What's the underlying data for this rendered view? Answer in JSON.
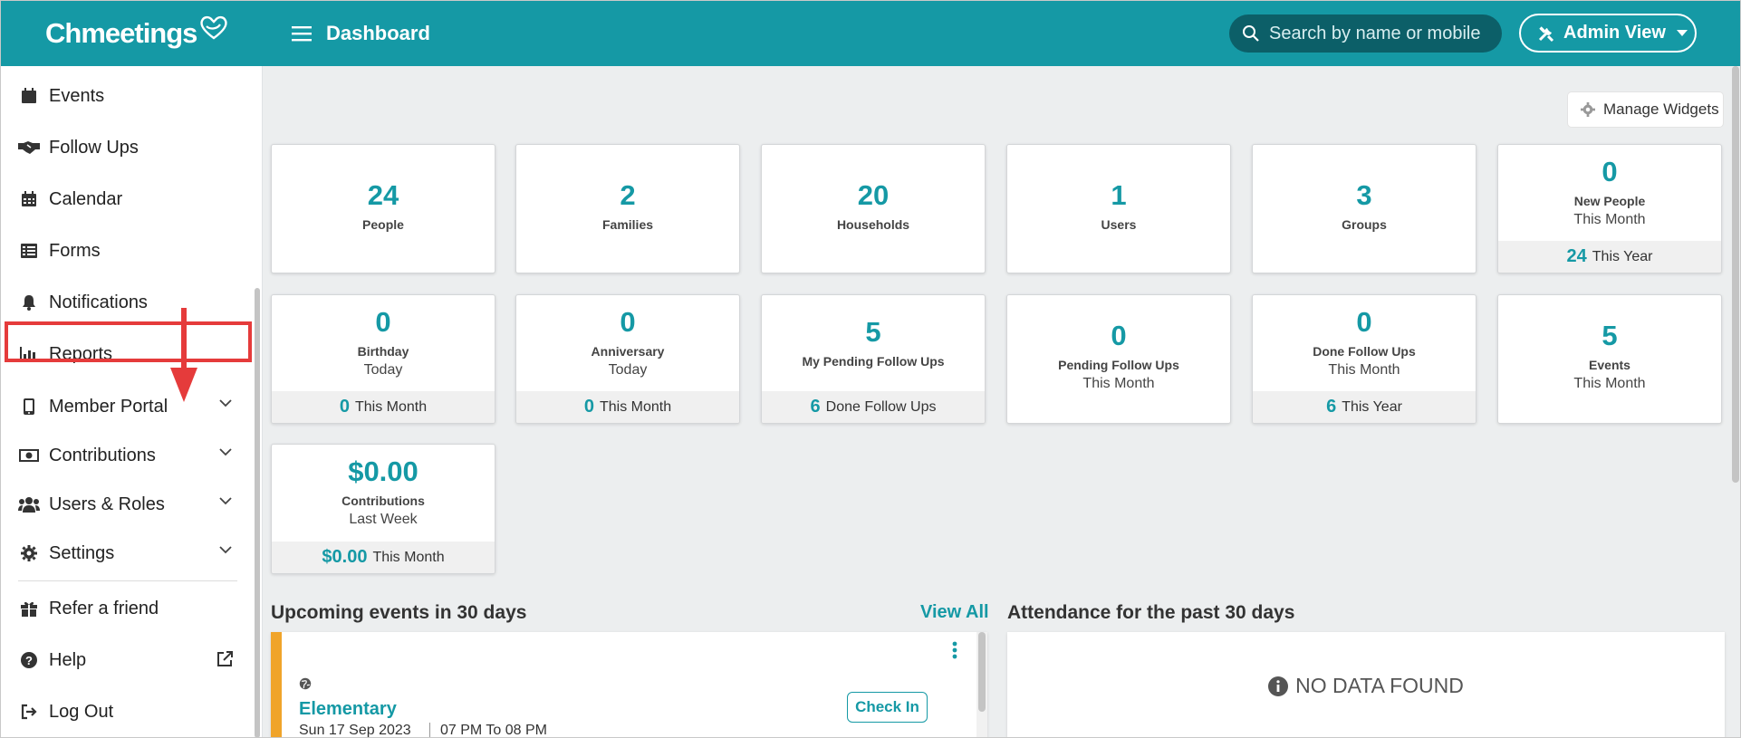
{
  "app": {
    "brand": "Chmeetings",
    "page_title": "Dashboard"
  },
  "header": {
    "search_placeholder": "Search by name or mobile",
    "admin_view_label": "Admin View"
  },
  "sidebar": {
    "items": [
      {
        "label": "Events",
        "icon": "calendar-icon"
      },
      {
        "label": "Follow Ups",
        "icon": "handshake-icon"
      },
      {
        "label": "Calendar",
        "icon": "calendar-grid-icon"
      },
      {
        "label": "Forms",
        "icon": "list-icon"
      },
      {
        "label": "Notifications",
        "icon": "bell-icon"
      },
      {
        "label": "Reports",
        "icon": "bar-chart-icon"
      },
      {
        "label": "Member Portal",
        "icon": "mobile-icon"
      },
      {
        "label": "Contributions",
        "icon": "money-icon"
      },
      {
        "label": "Users & Roles",
        "icon": "users-icon"
      },
      {
        "label": "Settings",
        "icon": "gear-icon"
      },
      {
        "label": "Refer a friend",
        "icon": "gift-icon"
      },
      {
        "label": "Help",
        "icon": "question-icon"
      },
      {
        "label": "Log Out",
        "icon": "logout-icon"
      }
    ]
  },
  "main": {
    "manage_widgets_label": "Manage Widgets",
    "widgets": {
      "people": {
        "value": "24",
        "label": "People"
      },
      "families": {
        "value": "2",
        "label": "Families"
      },
      "households": {
        "value": "20",
        "label": "Households"
      },
      "users": {
        "value": "1",
        "label": "Users"
      },
      "groups": {
        "value": "3",
        "label": "Groups"
      },
      "new_people": {
        "value": "0",
        "label": "New People",
        "sub": "This Month",
        "foot_value": "24",
        "foot_label": "This Year"
      },
      "birthday": {
        "value": "0",
        "label": "Birthday",
        "sub": "Today",
        "foot_value": "0",
        "foot_label": "This Month"
      },
      "anniversary": {
        "value": "0",
        "label": "Anniversary",
        "sub": "Today",
        "foot_value": "0",
        "foot_label": "This Month"
      },
      "my_pending": {
        "value": "5",
        "label": "My Pending Follow Ups",
        "foot_value": "6",
        "foot_label": "Done Follow Ups"
      },
      "pending": {
        "value": "0",
        "label": "Pending Follow Ups",
        "sub": "This Month"
      },
      "done": {
        "value": "0",
        "label": "Done Follow Ups",
        "sub": "This Month",
        "foot_value": "6",
        "foot_label": "This Year"
      },
      "events": {
        "value": "5",
        "label": "Events",
        "sub": "This Month"
      },
      "contributions": {
        "value": "$0.00",
        "label": "Contributions",
        "sub": "Last Week",
        "foot_value": "$0.00",
        "foot_label": "This Month"
      }
    },
    "upcoming": {
      "title": "Upcoming events in 30 days",
      "view_all": "View All",
      "event": {
        "name": "Elementary",
        "date": "Sun 17 Sep  2023",
        "time": "07 PM To 08 PM",
        "checkin_label": "Check In"
      }
    },
    "attendance": {
      "title": "Attendance for the past 30 days",
      "empty_text": "NO DATA FOUND"
    }
  },
  "colors": {
    "brand": "#1599a5",
    "header": "#1599a5",
    "highlight": "#e53b3b",
    "event_accent": "#f0a42a"
  }
}
